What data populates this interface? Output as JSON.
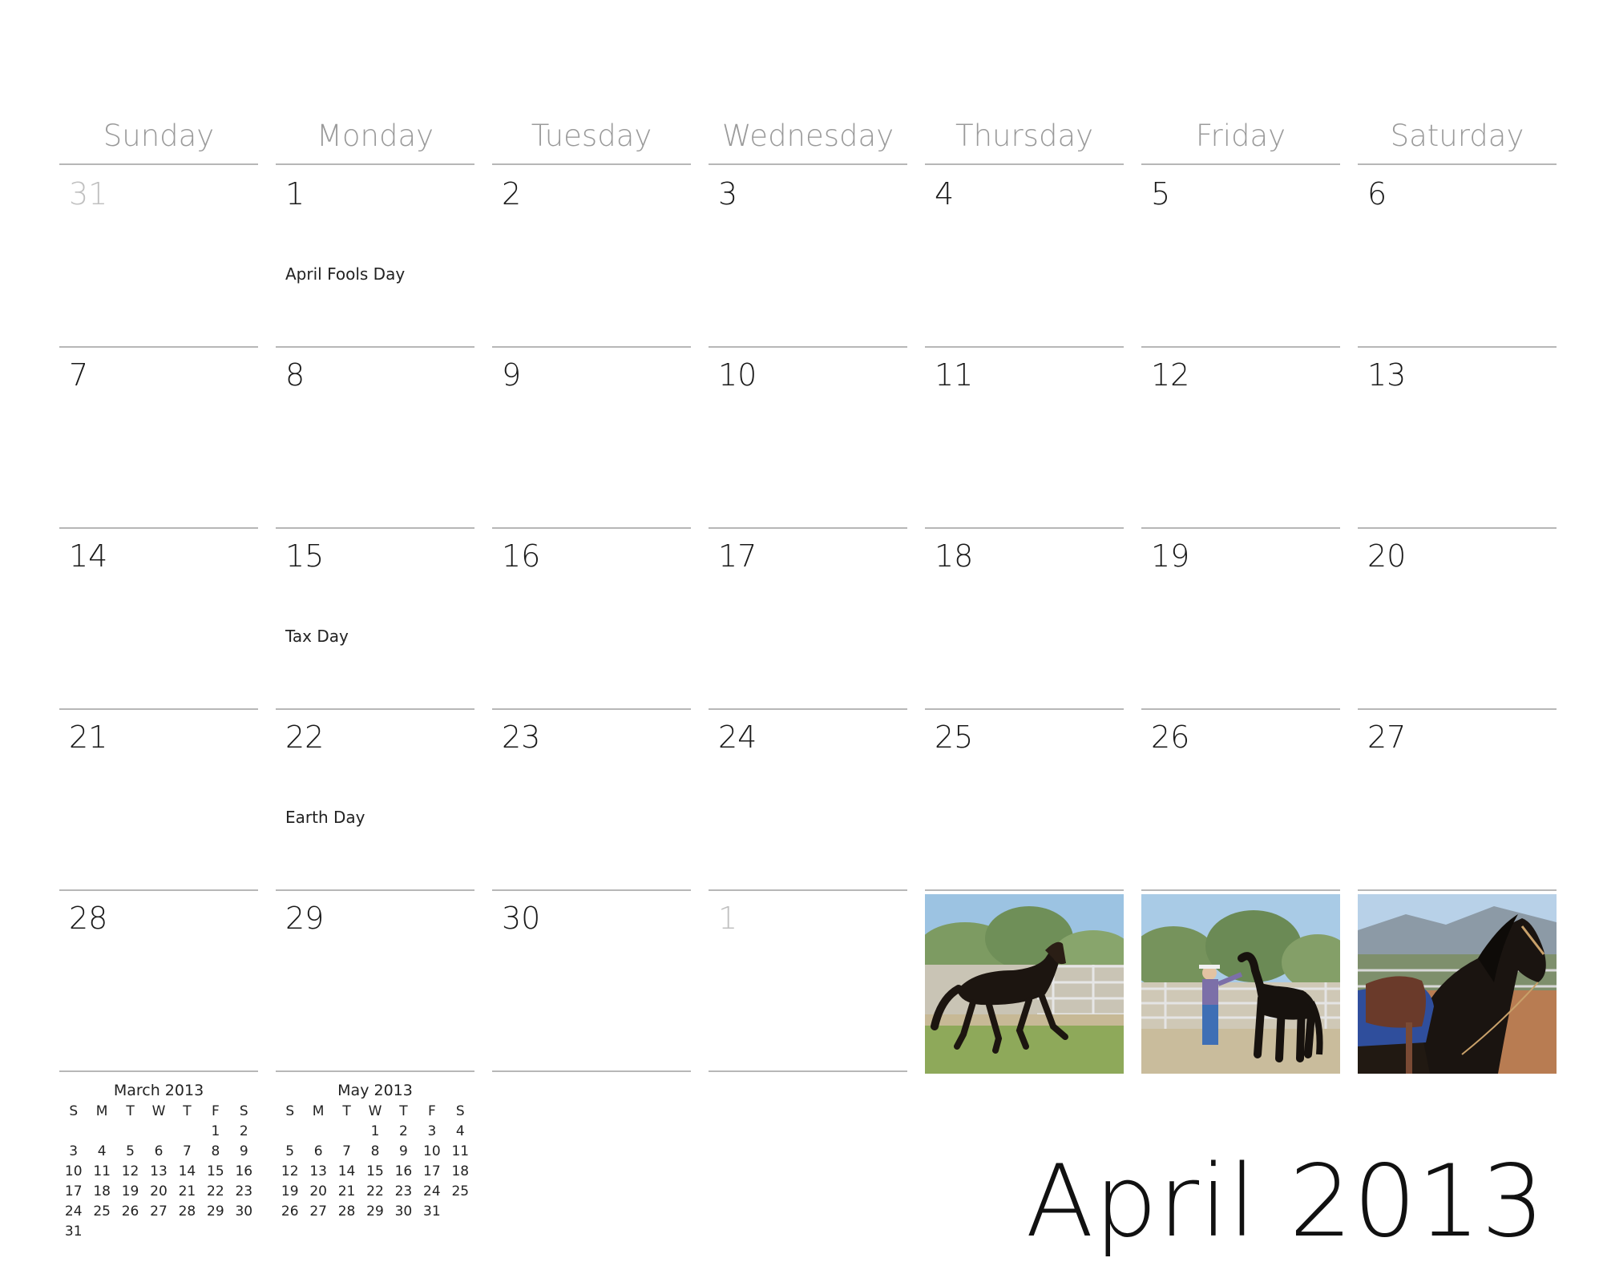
{
  "title": "April 2013",
  "weekdays": [
    "Sunday",
    "Monday",
    "Tuesday",
    "Wednesday",
    "Thursday",
    "Friday",
    "Saturday"
  ],
  "weeks": [
    [
      {
        "day": "31",
        "muted": true
      },
      {
        "day": "1",
        "event": "April Fools Day"
      },
      {
        "day": "2"
      },
      {
        "day": "3"
      },
      {
        "day": "4"
      },
      {
        "day": "5"
      },
      {
        "day": "6"
      }
    ],
    [
      {
        "day": "7"
      },
      {
        "day": "8"
      },
      {
        "day": "9"
      },
      {
        "day": "10"
      },
      {
        "day": "11"
      },
      {
        "day": "12"
      },
      {
        "day": "13"
      }
    ],
    [
      {
        "day": "14"
      },
      {
        "day": "15",
        "event": "Tax Day"
      },
      {
        "day": "16"
      },
      {
        "day": "17"
      },
      {
        "day": "18"
      },
      {
        "day": "19"
      },
      {
        "day": "20"
      }
    ],
    [
      {
        "day": "21"
      },
      {
        "day": "22",
        "event": "Earth Day"
      },
      {
        "day": "23"
      },
      {
        "day": "24"
      },
      {
        "day": "25"
      },
      {
        "day": "26"
      },
      {
        "day": "27"
      }
    ],
    [
      {
        "day": "28"
      },
      {
        "day": "29"
      },
      {
        "day": "30"
      },
      {
        "day": "1",
        "muted": true
      },
      {
        "photo": "horse-galloping"
      },
      {
        "photo": "man-with-horse"
      },
      {
        "photo": "horse-saddled-closeup"
      }
    ]
  ],
  "mini_calendars": [
    {
      "title": "March 2013",
      "headers": [
        "S",
        "M",
        "T",
        "W",
        "T",
        "F",
        "S"
      ],
      "rows": [
        [
          "",
          "",
          "",
          "",
          "",
          "1",
          "2"
        ],
        [
          "3",
          "4",
          "5",
          "6",
          "7",
          "8",
          "9"
        ],
        [
          "10",
          "11",
          "12",
          "13",
          "14",
          "15",
          "16"
        ],
        [
          "17",
          "18",
          "19",
          "20",
          "21",
          "22",
          "23"
        ],
        [
          "24",
          "25",
          "26",
          "27",
          "28",
          "29",
          "30"
        ],
        [
          "31",
          "",
          "",
          "",
          "",
          "",
          ""
        ]
      ]
    },
    {
      "title": "May 2013",
      "headers": [
        "S",
        "M",
        "T",
        "W",
        "T",
        "F",
        "S"
      ],
      "rows": [
        [
          "",
          "",
          "",
          "1",
          "2",
          "3",
          "4"
        ],
        [
          "5",
          "6",
          "7",
          "8",
          "9",
          "10",
          "11"
        ],
        [
          "12",
          "13",
          "14",
          "15",
          "16",
          "17",
          "18"
        ],
        [
          "19",
          "20",
          "21",
          "22",
          "23",
          "24",
          "25"
        ],
        [
          "26",
          "27",
          "28",
          "29",
          "30",
          "31",
          ""
        ]
      ]
    }
  ],
  "colors": {
    "rule": "#b7b7b7",
    "weekday_text": "#9a9a9a",
    "muted_day": "#c0c0c0"
  }
}
